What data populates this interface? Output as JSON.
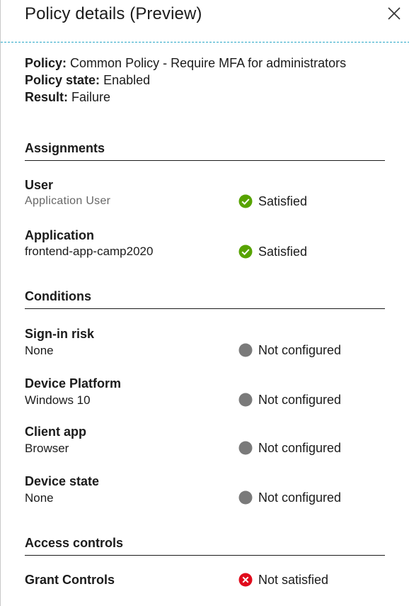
{
  "header": {
    "title": "Policy details (Preview)"
  },
  "summary": {
    "policy_label": "Policy:",
    "policy_value": "Common Policy - Require MFA for administrators",
    "state_label": "Policy state:",
    "state_value": "Enabled",
    "result_label": "Result:",
    "result_value": "Failure"
  },
  "assignments": {
    "heading": "Assignments",
    "items": [
      {
        "label": "User",
        "value": "Application User",
        "status": "Satisfied",
        "icon": "check-circle-icon"
      },
      {
        "label": "Application",
        "value": "frontend-app-camp2020",
        "status": "Satisfied",
        "icon": "check-circle-icon"
      }
    ]
  },
  "conditions": {
    "heading": "Conditions",
    "items": [
      {
        "label": "Sign-in risk",
        "value": "None",
        "status": "Not configured",
        "icon": "gray-circle-icon"
      },
      {
        "label": "Device Platform",
        "value": "Windows 10",
        "status": "Not configured",
        "icon": "gray-circle-icon"
      },
      {
        "label": "Client app",
        "value": "Browser",
        "status": "Not configured",
        "icon": "gray-circle-icon"
      },
      {
        "label": "Device state",
        "value": "None",
        "status": "Not configured",
        "icon": "gray-circle-icon"
      }
    ]
  },
  "access_controls": {
    "heading": "Access controls",
    "items": [
      {
        "label": "Grant Controls",
        "status": "Not satisfied",
        "icon": "error-circle-icon"
      }
    ]
  },
  "colors": {
    "success": "#57a300",
    "neutral": "#7a7a7a",
    "error": "#e00b1c",
    "accent_border": "#2aa7c7"
  }
}
